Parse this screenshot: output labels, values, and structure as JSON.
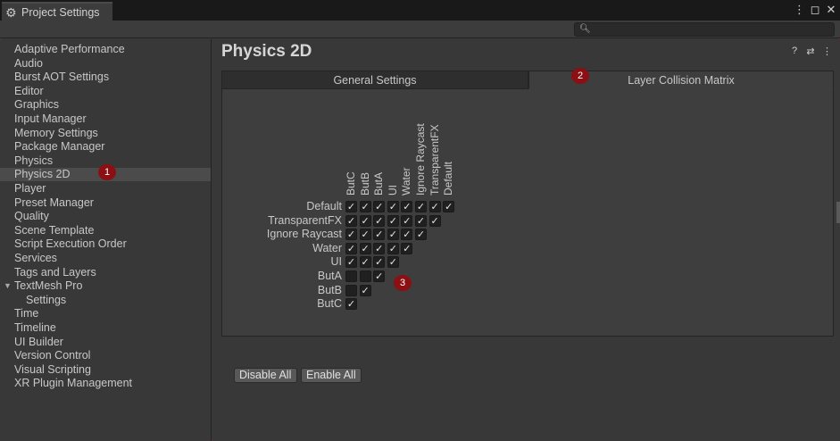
{
  "window": {
    "title": "Project Settings",
    "icons": {
      "gear": "gear-icon",
      "menu": "⋮",
      "maximize": "◻",
      "close": "✕"
    }
  },
  "search": {
    "icon": "search-icon",
    "placeholder": ""
  },
  "sidebar": {
    "items": [
      {
        "label": "Adaptive Performance"
      },
      {
        "label": "Audio"
      },
      {
        "label": "Burst AOT Settings"
      },
      {
        "label": "Editor"
      },
      {
        "label": "Graphics"
      },
      {
        "label": "Input Manager"
      },
      {
        "label": "Memory Settings"
      },
      {
        "label": "Package Manager"
      },
      {
        "label": "Physics"
      },
      {
        "label": "Physics 2D",
        "selected": true
      },
      {
        "label": "Player"
      },
      {
        "label": "Preset Manager"
      },
      {
        "label": "Quality"
      },
      {
        "label": "Scene Template"
      },
      {
        "label": "Script Execution Order"
      },
      {
        "label": "Services"
      },
      {
        "label": "Tags and Layers"
      },
      {
        "label": "TextMesh Pro",
        "expanded": true
      },
      {
        "label": "Settings",
        "sub": true
      },
      {
        "label": "Time"
      },
      {
        "label": "Timeline"
      },
      {
        "label": "UI Builder"
      },
      {
        "label": "Version Control"
      },
      {
        "label": "Visual Scripting"
      },
      {
        "label": "XR Plugin Management"
      }
    ]
  },
  "main": {
    "title": "Physics 2D",
    "header_icons": [
      "help-icon",
      "preset-icon",
      "more-icon"
    ],
    "tabs": [
      {
        "label": "General Settings",
        "active": false
      },
      {
        "label": "Layer Collision Matrix",
        "active": true
      }
    ],
    "matrix": {
      "column_labels": [
        "ButC",
        "ButB",
        "ButA",
        "UI",
        "Water",
        "Ignore Raycast",
        "TransparentFX",
        "Default"
      ],
      "rows": [
        {
          "label": "Default",
          "checks": [
            true,
            true,
            true,
            true,
            true,
            true,
            true,
            true
          ]
        },
        {
          "label": "TransparentFX",
          "checks": [
            true,
            true,
            true,
            true,
            true,
            true,
            true
          ]
        },
        {
          "label": "Ignore Raycast",
          "checks": [
            true,
            true,
            true,
            true,
            true,
            true
          ]
        },
        {
          "label": "Water",
          "checks": [
            true,
            true,
            true,
            true,
            true
          ]
        },
        {
          "label": "UI",
          "checks": [
            true,
            true,
            true,
            true
          ]
        },
        {
          "label": "ButA",
          "checks": [
            false,
            false,
            true
          ]
        },
        {
          "label": "ButB",
          "checks": [
            false,
            true
          ]
        },
        {
          "label": "ButC",
          "checks": [
            true
          ]
        }
      ]
    },
    "buttons": {
      "disable_all": "Disable All",
      "enable_all": "Enable All"
    }
  },
  "badges": {
    "b1": "1",
    "b2": "2",
    "b3": "3",
    "color": "#8b0f13"
  },
  "colors": {
    "background": "#383838",
    "titlebar": "#191919",
    "selected_item": "#4b4b4b",
    "checkbox": "#202020"
  }
}
